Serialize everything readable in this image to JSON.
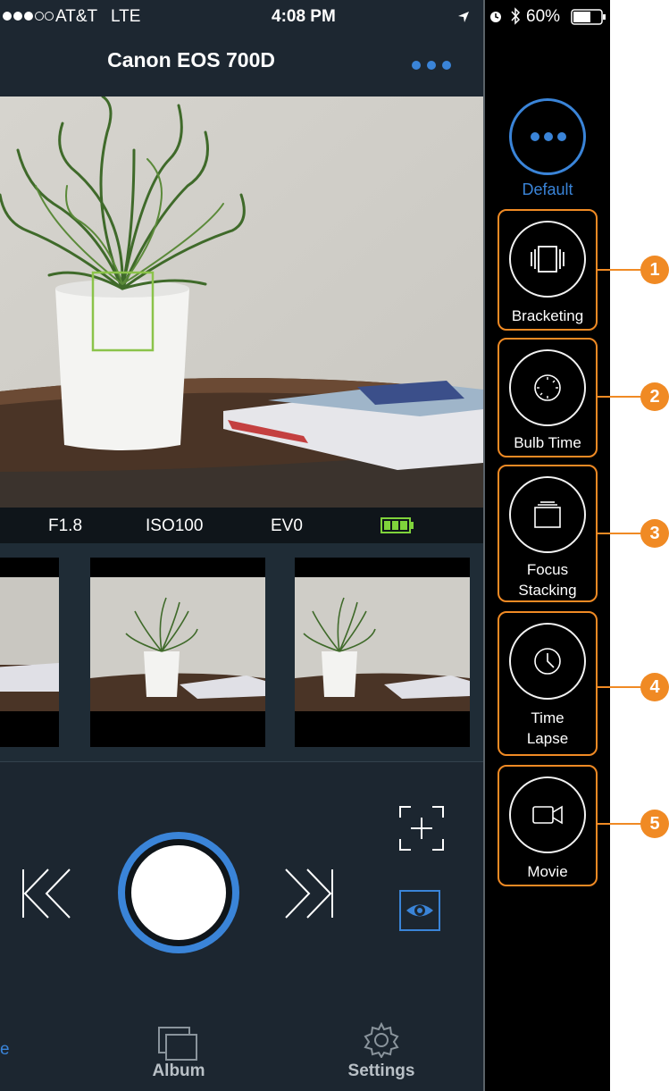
{
  "status_bar": {
    "carrier": "AT&T",
    "network": "LTE",
    "time": "4:08 PM",
    "battery": "60%"
  },
  "nav": {
    "title": "Canon EOS 700D"
  },
  "info_bar": {
    "aperture": "F1.8",
    "iso": "ISO100",
    "ev": "EV0"
  },
  "tabs": [
    {
      "label": "e",
      "icon": "camera-icon",
      "active": true
    },
    {
      "label": "Album",
      "icon": "album-icon"
    },
    {
      "label": "Settings",
      "icon": "gear-icon"
    }
  ],
  "side_panel": {
    "default_label": "Default",
    "modes": [
      {
        "label": "Bracketing",
        "icon": "bracketing-icon",
        "callout": "1"
      },
      {
        "label": "Bulb Time",
        "icon": "bulb-timer-icon",
        "callout": "2"
      },
      {
        "label": "Focus Stacking",
        "icon": "focus-stacking-icon",
        "callout": "3"
      },
      {
        "label": "Time Lapse",
        "icon": "clock-icon",
        "callout": "4"
      },
      {
        "label": "Movie",
        "icon": "video-camera-icon",
        "callout": "5"
      }
    ]
  },
  "colors": {
    "accent": "#3a84d8",
    "callout": "#f08a24",
    "app_bg": "#1c2630",
    "focus_box": "#8bc34a",
    "battery_green": "#7fd33b"
  }
}
